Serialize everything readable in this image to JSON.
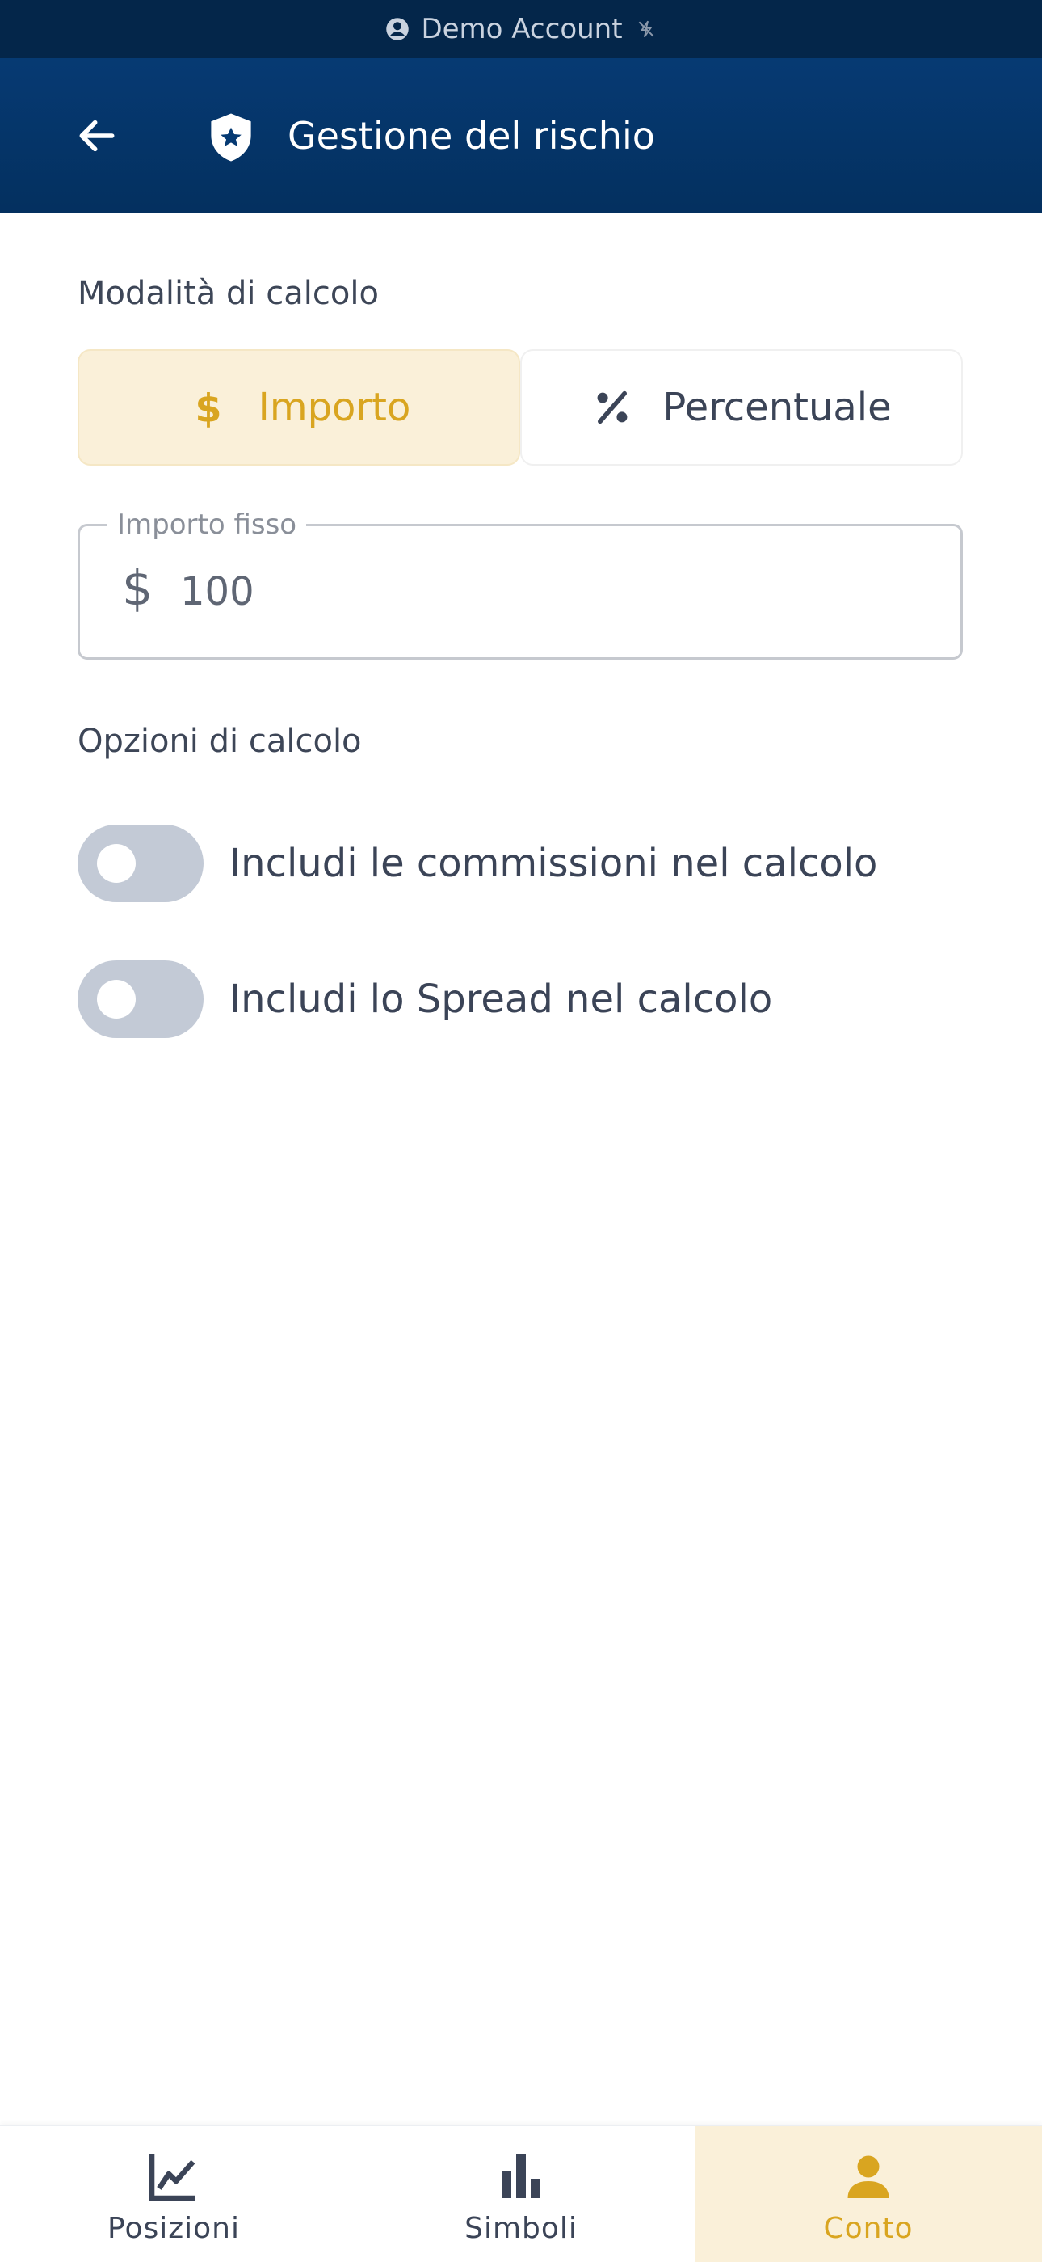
{
  "status_bar": {
    "account_label": "Demo Account",
    "account_icon": "account-circle-icon",
    "sync_icon": "sync-off-icon"
  },
  "app_bar": {
    "title": "Gestione del rischio",
    "back_icon": "arrow-left-icon",
    "shield_icon": "shield-star-icon"
  },
  "calc_mode": {
    "label": "Modalità di calcolo",
    "options": [
      {
        "label": "Importo",
        "icon": "dollar-icon",
        "selected": true
      },
      {
        "label": "Percentuale",
        "icon": "percent-icon",
        "selected": false
      }
    ]
  },
  "fixed_amount": {
    "label": "Importo fisso",
    "currency": "$",
    "value": "100"
  },
  "calc_options": {
    "label": "Opzioni di calcolo",
    "toggles": [
      {
        "label": "Includi le commissioni nel calcolo",
        "on": false
      },
      {
        "label": "Includi lo Spread nel calcolo",
        "on": false
      }
    ]
  },
  "bottom_nav": {
    "items": [
      {
        "label": "Posizioni",
        "icon": "chart-line-icon",
        "active": false
      },
      {
        "label": "Simboli",
        "icon": "bar-chart-icon",
        "active": false
      },
      {
        "label": "Conto",
        "icon": "person-icon",
        "active": true
      }
    ]
  },
  "colors": {
    "primary": "#063a73",
    "accent": "#d9a520",
    "accent_bg": "#faf0d9",
    "toggle_off": "#c3cad6"
  }
}
